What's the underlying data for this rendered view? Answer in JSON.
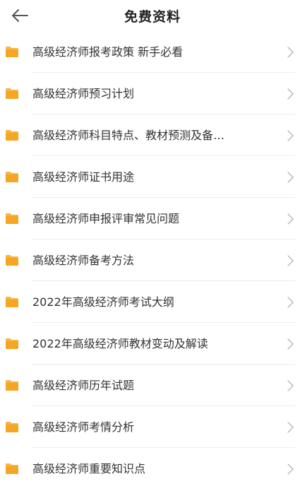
{
  "header": {
    "title": "免费资料",
    "back_icon": "arrow-left-icon"
  },
  "colors": {
    "folder": "#F5A623",
    "folder_tab": "#F7B543",
    "chevron": "#B5B5B5",
    "text": "#333333"
  },
  "items": [
    {
      "label": "高级经济师报考政策 新手必看",
      "icon": "folder-icon"
    },
    {
      "label": "高级经济师预习计划",
      "icon": "folder-icon"
    },
    {
      "label": "高级经济师科目特点、教材预测及备…",
      "icon": "folder-icon"
    },
    {
      "label": "高级经济师证书用途",
      "icon": "folder-icon"
    },
    {
      "label": "高级经济师申报评审常见问题",
      "icon": "folder-icon"
    },
    {
      "label": "高级经济师备考方法",
      "icon": "folder-icon"
    },
    {
      "label": "2022年高级经济师考试大纲",
      "icon": "folder-icon"
    },
    {
      "label": "2022年高级经济师教材变动及解读",
      "icon": "folder-icon"
    },
    {
      "label": "高级经济师历年试题",
      "icon": "folder-icon"
    },
    {
      "label": "高级经济师考情分析",
      "icon": "folder-icon"
    },
    {
      "label": "高级经济师重要知识点",
      "icon": "folder-icon"
    }
  ]
}
